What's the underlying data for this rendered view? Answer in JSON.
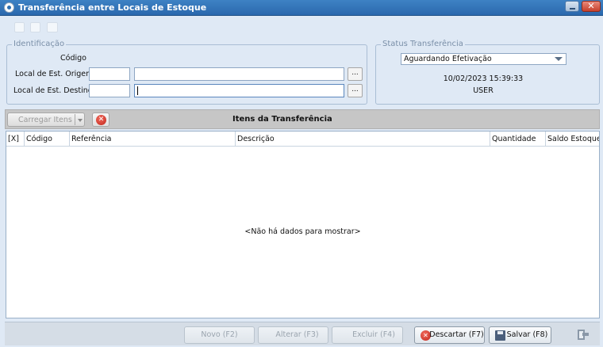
{
  "window": {
    "title": "Transferência entre Locais de Estoque",
    "close_glyph": "✕"
  },
  "identificacao": {
    "group_title": "Identificação",
    "codigo_label": "Código",
    "origem_label": "Local de Est. Origem",
    "destino_label": "Local de Est. Destino",
    "origem_code": "",
    "origem_desc": "",
    "destino_code": "",
    "destino_desc": "",
    "lookup_glyph": "..."
  },
  "status": {
    "group_title": "Status Transferência",
    "selected": "Aguardando Efetivação",
    "datetime": "10/02/2023 15:39:33",
    "user": "USER"
  },
  "items_bar": {
    "load_button": "Carregar Itens",
    "title": "Itens da Transferência",
    "delete_glyph": "✕"
  },
  "grid": {
    "columns": [
      "[X]",
      "Código",
      "Referência",
      "Descrição",
      "Quantidade",
      "Saldo Estoque"
    ],
    "empty_text": "<Não há dados para mostrar>"
  },
  "footer": {
    "novo": "Novo (F2)",
    "alterar": "Alterar (F3)",
    "excluir": "Excluir (F4)",
    "descartar": "Descartar (F7)",
    "salvar": "Salvar (F8)",
    "descartar_glyph": "✕"
  },
  "colors": {
    "title_bar": "#2a68ad",
    "background": "#dfe9f5",
    "accent_red": "#c0261b"
  }
}
